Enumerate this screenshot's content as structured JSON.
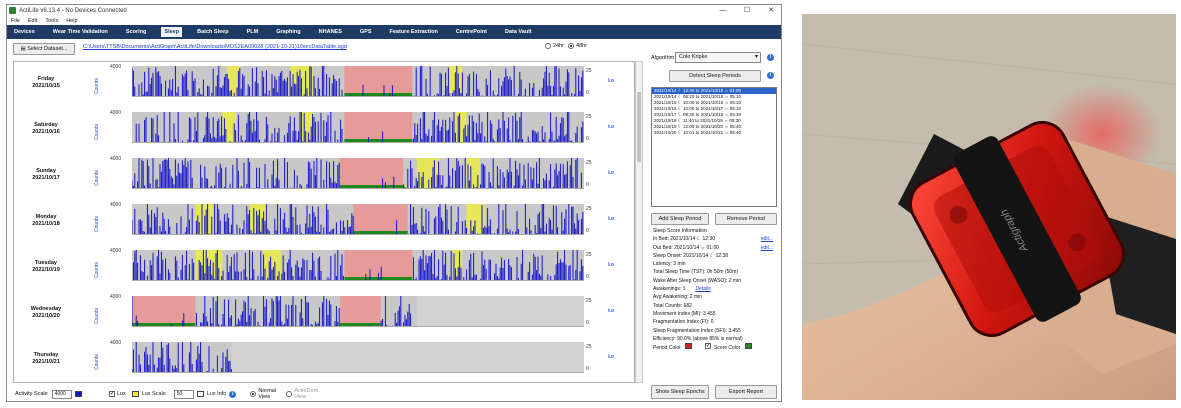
{
  "window": {
    "title": "ActiLife v6.13.4 - No Devices Connected",
    "controls": [
      "—",
      "☐",
      "✕"
    ]
  },
  "menu": [
    "File",
    "Edit",
    "Tools",
    "Help"
  ],
  "tabs": [
    "Devices",
    "Wear Time Validation",
    "Scoring",
    "Sleep",
    "Batch Sleep",
    "PLM",
    "Graphing",
    "NHANES",
    "GPS",
    "Feature Extraction",
    "CentrePoint",
    "Data Vault"
  ],
  "active_tab": "Sleep",
  "toolbar": {
    "select_dataset_label": "Select Dataset...",
    "file_path": "C:\\Users\\TTSB\\Documents\\ActiGraph\\ActiLife\\Downloads\\MOS2EA09028 (2021-10-21)10secDataTable.agd",
    "hours_24_label": "24hr",
    "hours_48_label": "48hr",
    "selected_hours": "48hr"
  },
  "plot": {
    "count_label": "Counts",
    "ymax": "4000",
    "right_ticks": [
      "25",
      "0"
    ],
    "lux_label": "lux",
    "colors": {
      "activity": "#1414c8",
      "sleep": "#e79a9a",
      "score": "#1e8a1e",
      "lux": "#e6e65a",
      "background": "#c6c6c6"
    },
    "days": [
      {
        "name": "Friday",
        "date": "2021/10/15"
      },
      {
        "name": "Saturday",
        "date": "2021/10/16"
      },
      {
        "name": "Sunday",
        "date": "2021/10/17"
      },
      {
        "name": "Monday",
        "date": "2021/10/18"
      },
      {
        "name": "Tuesday",
        "date": "2021/10/19"
      },
      {
        "name": "Wednesday",
        "date": "2021/10/20"
      },
      {
        "name": "Thursday",
        "date": "2021/10/21"
      }
    ]
  },
  "bottom": {
    "activity_scale_label": "Activity Scale",
    "activity_scale_value": "4000",
    "lux_label": "Lux",
    "lux_scale_label": "Lux Scale",
    "lux_scale_value": "50",
    "lux_info_label": "Lux Info",
    "normal_view_label": "Normal View",
    "actiodom_view_label": "ActioDom View"
  },
  "right_panel": {
    "algorithm_label": "Algorithm:",
    "algorithm_value": "Cole Kripke",
    "detect_label": "Detect Sleep Periods",
    "periods": [
      "2021/10/14 ☾ 12:30 to 2021/10/15 ☼ 01:00",
      "2021/10/14 ☾ 06:20 to 2021/10/15 ☼ 05:10",
      "2021/10/15 ☾ 10:00 to 2021/10/16 ☼ 05:10",
      "2021/10/16 ☾ 10:00 to 2021/10/17 ☼ 05:10",
      "2021/10/17 ☾ 09:30 to 2021/10/18 ☼ 05:30",
      "2021/10/18 ☾ 11:40 to 2021/10/19 ☼ 05:30",
      "2021/10/19 ☾ 12:00 to 2021/10/20 ☼ 05:40",
      "2021/10/20 ☾ 10:01 to 2021/10/21 ☼ 05:40"
    ],
    "add_label": "Add Sleep Period",
    "remove_label": "Remove Period",
    "score_title": "Sleep Score Information",
    "in_bed": "In Bed:  2021/10/14 ☾ 12:30",
    "out_bed": "Out Bed:  2021/10/14 ☼ 01:00",
    "edit_label": "edit...",
    "sleep_onset": "Sleep Onset:  2021/10/14 ☾ 12:38",
    "latency": "Latency: 3 min",
    "tst": "Total Sleep Time (TST): 0h 50m (50m)",
    "waso": "Wake After Sleep Onset (WASO): 2 min",
    "awakenings": "Awakenings: 1",
    "details_label": "Details",
    "avg_awakening": "Avg Awakening: 2 min",
    "total_counts": "Total Counts: 682",
    "movement": "Movement Index (MI): 3.455",
    "fragmentation": "Fragmentation Index (FI): 0",
    "sfi": "Sleep Fragmentation Index (SFI): 3.455",
    "efficiency": "Efficiency: 90.0% (above 85% is normal)",
    "period_color_label": "Period Color",
    "score_color_label": "Score Color",
    "show_epochs_label": "Show Sleep Epochs",
    "export_label": "Export Report"
  },
  "photo": {
    "logo_text": "Actigraph"
  }
}
